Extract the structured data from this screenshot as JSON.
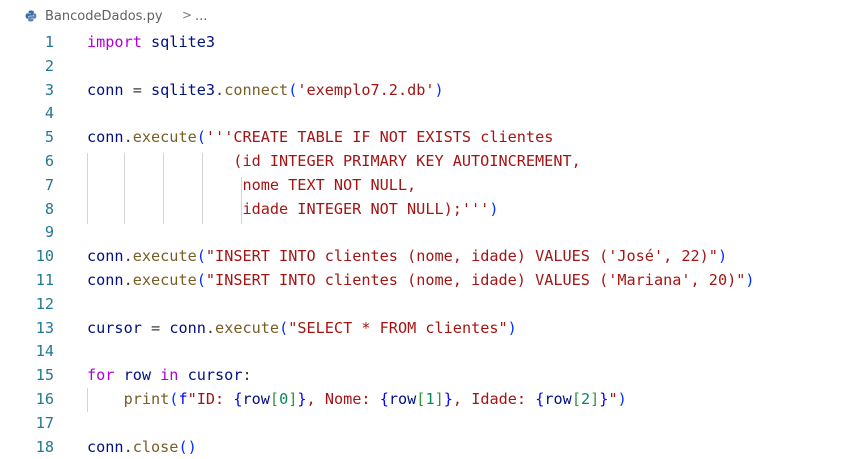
{
  "breadcrumb": {
    "file_name": "BancodeDados.py",
    "separator": ">",
    "ellipsis": "..."
  },
  "editor": {
    "lines": [
      {
        "num": "1",
        "tokens": [
          {
            "t": "import",
            "c": "ctrl"
          },
          {
            "t": " sqlite3",
            "c": "id"
          }
        ]
      },
      {
        "num": "2",
        "tokens": []
      },
      {
        "num": "3",
        "tokens": [
          {
            "t": "conn",
            "c": "id"
          },
          {
            "t": " = ",
            "c": "op"
          },
          {
            "t": "sqlite3",
            "c": "id"
          },
          {
            "t": ".",
            "c": "op"
          },
          {
            "t": "connect",
            "c": "fn"
          },
          {
            "t": "(",
            "c": "p1"
          },
          {
            "t": "'exemplo7.2.db'",
            "c": "str"
          },
          {
            "t": ")",
            "c": "p1"
          }
        ]
      },
      {
        "num": "4",
        "tokens": []
      },
      {
        "num": "5",
        "tokens": [
          {
            "t": "conn",
            "c": "id"
          },
          {
            "t": ".",
            "c": "op"
          },
          {
            "t": "execute",
            "c": "fn"
          },
          {
            "t": "(",
            "c": "p1"
          },
          {
            "t": "'''CREATE TABLE IF NOT EXISTS clientes",
            "c": "str"
          }
        ]
      },
      {
        "num": "6",
        "tokens": [
          {
            "t": "                (id INTEGER PRIMARY KEY AUTOINCREMENT,",
            "c": "str"
          }
        ]
      },
      {
        "num": "7",
        "tokens": [
          {
            "t": "                 nome TEXT NOT NULL,",
            "c": "str"
          }
        ]
      },
      {
        "num": "8",
        "tokens": [
          {
            "t": "                 idade INTEGER NOT NULL);'''",
            "c": "str"
          },
          {
            "t": ")",
            "c": "p1"
          }
        ]
      },
      {
        "num": "9",
        "tokens": []
      },
      {
        "num": "10",
        "tokens": [
          {
            "t": "conn",
            "c": "id"
          },
          {
            "t": ".",
            "c": "op"
          },
          {
            "t": "execute",
            "c": "fn"
          },
          {
            "t": "(",
            "c": "p1"
          },
          {
            "t": "\"INSERT INTO clientes (nome, idade) VALUES ('José', 22)\"",
            "c": "str"
          },
          {
            "t": ")",
            "c": "p1"
          }
        ]
      },
      {
        "num": "11",
        "tokens": [
          {
            "t": "conn",
            "c": "id"
          },
          {
            "t": ".",
            "c": "op"
          },
          {
            "t": "execute",
            "c": "fn"
          },
          {
            "t": "(",
            "c": "p1"
          },
          {
            "t": "\"INSERT INTO clientes (nome, idade) VALUES ('Mariana', 20)\"",
            "c": "str"
          },
          {
            "t": ")",
            "c": "p1"
          }
        ]
      },
      {
        "num": "12",
        "tokens": []
      },
      {
        "num": "13",
        "tokens": [
          {
            "t": "cursor",
            "c": "id"
          },
          {
            "t": " = ",
            "c": "op"
          },
          {
            "t": "conn",
            "c": "id"
          },
          {
            "t": ".",
            "c": "op"
          },
          {
            "t": "execute",
            "c": "fn"
          },
          {
            "t": "(",
            "c": "p1"
          },
          {
            "t": "\"SELECT * FROM clientes\"",
            "c": "str"
          },
          {
            "t": ")",
            "c": "p1"
          }
        ]
      },
      {
        "num": "14",
        "tokens": []
      },
      {
        "num": "15",
        "tokens": [
          {
            "t": "for",
            "c": "ctrl"
          },
          {
            "t": " row ",
            "c": "id"
          },
          {
            "t": "in",
            "c": "ctrl"
          },
          {
            "t": " cursor",
            "c": "id"
          },
          {
            "t": ":",
            "c": "op"
          }
        ]
      },
      {
        "num": "16",
        "tokens": [
          {
            "t": "    ",
            "c": "op"
          },
          {
            "t": "print",
            "c": "fn"
          },
          {
            "t": "(",
            "c": "p1"
          },
          {
            "t": "f",
            "c": "kw"
          },
          {
            "t": "\"ID: ",
            "c": "str"
          },
          {
            "t": "{",
            "c": "kw"
          },
          {
            "t": "row",
            "c": "id"
          },
          {
            "t": "[",
            "c": "p2"
          },
          {
            "t": "0",
            "c": "num"
          },
          {
            "t": "]",
            "c": "p2"
          },
          {
            "t": "}",
            "c": "kw"
          },
          {
            "t": ", Nome: ",
            "c": "str"
          },
          {
            "t": "{",
            "c": "kw"
          },
          {
            "t": "row",
            "c": "id"
          },
          {
            "t": "[",
            "c": "p2"
          },
          {
            "t": "1",
            "c": "num"
          },
          {
            "t": "]",
            "c": "p2"
          },
          {
            "t": "}",
            "c": "kw"
          },
          {
            "t": ", Idade: ",
            "c": "str"
          },
          {
            "t": "{",
            "c": "kw"
          },
          {
            "t": "row",
            "c": "id"
          },
          {
            "t": "[",
            "c": "p2"
          },
          {
            "t": "2",
            "c": "num"
          },
          {
            "t": "]",
            "c": "p2"
          },
          {
            "t": "}",
            "c": "kw"
          },
          {
            "t": "\"",
            "c": "str"
          },
          {
            "t": ")",
            "c": "p1"
          }
        ]
      },
      {
        "num": "17",
        "tokens": []
      },
      {
        "num": "18",
        "tokens": [
          {
            "t": "conn",
            "c": "id"
          },
          {
            "t": ".",
            "c": "op"
          },
          {
            "t": "close",
            "c": "fn"
          },
          {
            "t": "()",
            "c": "p1"
          }
        ]
      }
    ]
  }
}
